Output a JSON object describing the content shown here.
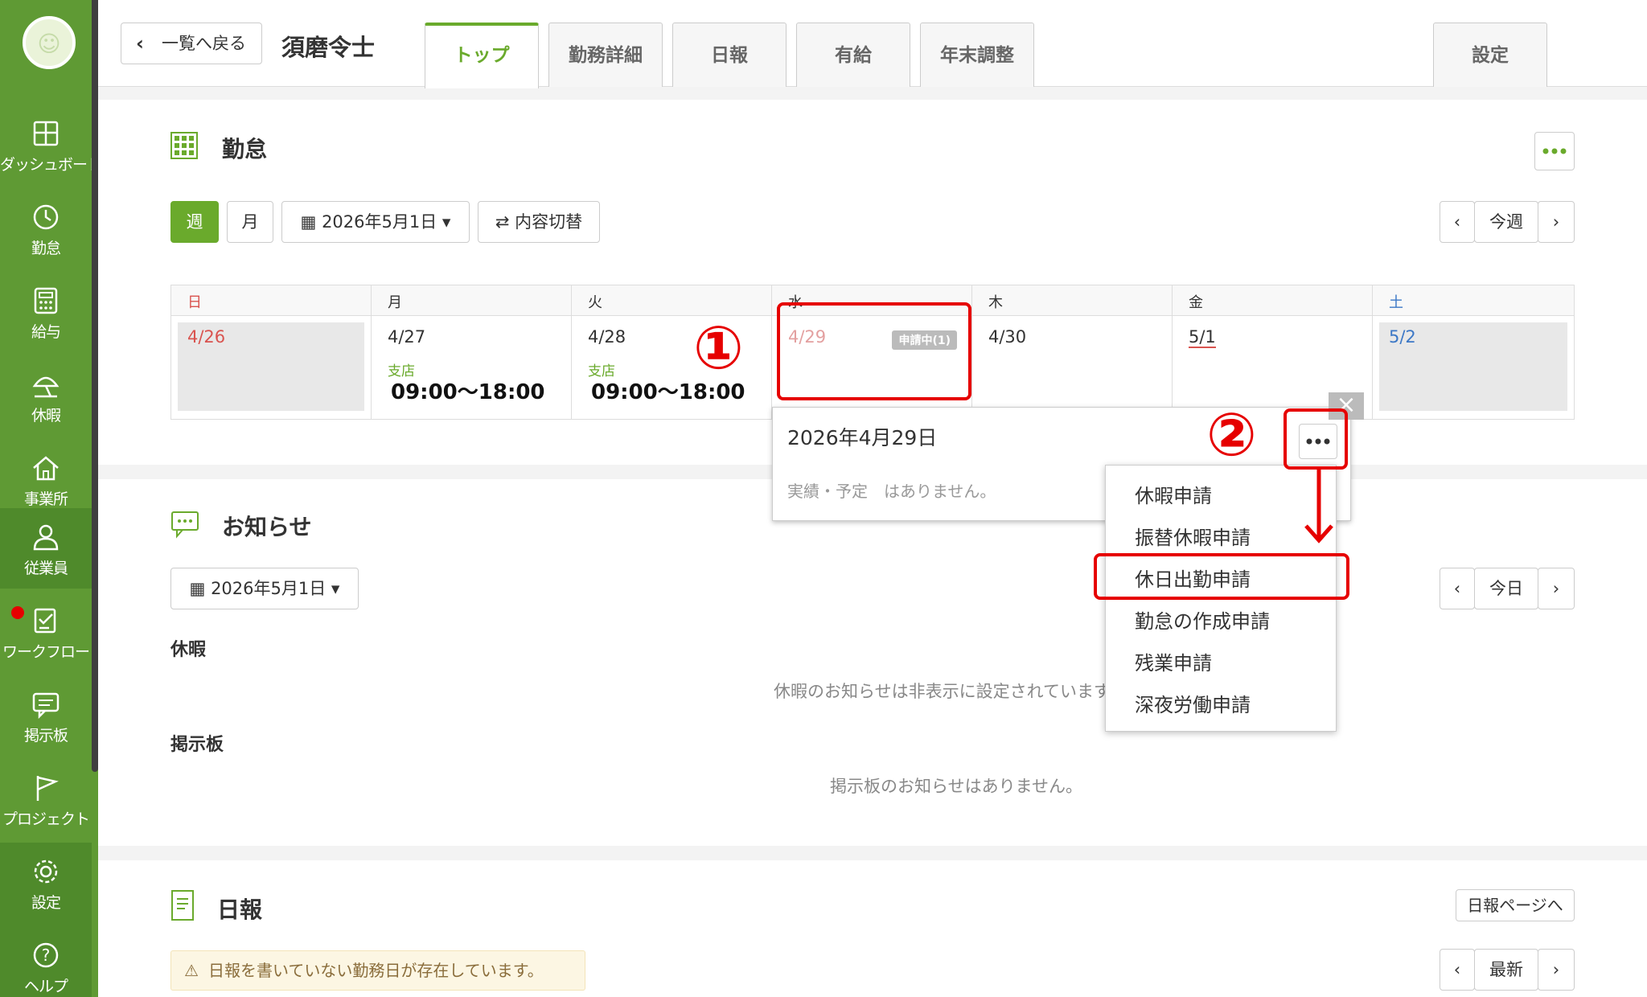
{
  "sidebar": {
    "logo_glyph": "☺",
    "items": [
      {
        "label": "ダッシュボード",
        "icon": "dashboard-icon"
      },
      {
        "label": "勤怠",
        "icon": "clock-icon"
      },
      {
        "label": "給与",
        "icon": "calculator-icon"
      },
      {
        "label": "休暇",
        "icon": "umbrella-icon"
      },
      {
        "label": "事業所",
        "icon": "home-icon"
      },
      {
        "label": "従業員",
        "icon": "person-icon"
      },
      {
        "label": "ワークフロー",
        "icon": "checklist-icon"
      },
      {
        "label": "掲示板",
        "icon": "chat-icon"
      },
      {
        "label": "プロジェクト",
        "icon": "flag-icon"
      },
      {
        "label": "設定",
        "icon": "gear-icon"
      },
      {
        "label": "ヘルプ",
        "icon": "help-icon"
      }
    ],
    "active_color": "#4f8a2b",
    "bg_color": "#5f9a34"
  },
  "header": {
    "back_label": "一覧へ戻る",
    "employee_name": "須磨令士",
    "tabs": [
      "トップ",
      "勤務詳細",
      "日報",
      "有給",
      "年末調整"
    ],
    "settings_tab": "設定",
    "accent_color": "#6aaa2c"
  },
  "attendance": {
    "title": "勤怠",
    "week_btn": "週",
    "month_btn": "月",
    "date_picker": "2026年5月1日",
    "toggle_btn": "内容切替",
    "nav_prev": "‹",
    "nav_current": "今週",
    "nav_next": "›",
    "days": [
      {
        "dow": "日",
        "date": "4/26"
      },
      {
        "dow": "月",
        "date": "4/27",
        "location": "支店",
        "time": "09:00～18:00"
      },
      {
        "dow": "火",
        "date": "4/28",
        "location": "支店",
        "time": "09:00～18:00"
      },
      {
        "dow": "水",
        "date": "4/29",
        "badge": "申請中(1)"
      },
      {
        "dow": "木",
        "date": "4/30"
      },
      {
        "dow": "金",
        "date": "5/1"
      },
      {
        "dow": "土",
        "date": "5/2"
      }
    ]
  },
  "popover": {
    "date": "2026年4月29日",
    "note": "実績・予定　はありません。",
    "close": "×"
  },
  "dropdown_menu": {
    "items": [
      "休暇申請",
      "振替休暇申請",
      "休日出勤申請",
      "勤怠の作成申請",
      "残業申請",
      "深夜労働申請"
    ]
  },
  "annotations": {
    "step1": "①",
    "step2": "②",
    "color": "#e60000"
  },
  "notices": {
    "title": "お知らせ",
    "date_picker": "2026年5月1日",
    "nav_current": "今日",
    "leave_heading": "休暇",
    "leave_message": "休暇のお知らせは非表示に設定されています。",
    "board_heading": "掲示板",
    "board_message": "掲示板のお知らせはありません。"
  },
  "daily_report": {
    "title": "日報",
    "page_link": "日報ページへ",
    "alert": "日報を書いていない勤務日が存在しています。",
    "nav_current": "最新"
  }
}
